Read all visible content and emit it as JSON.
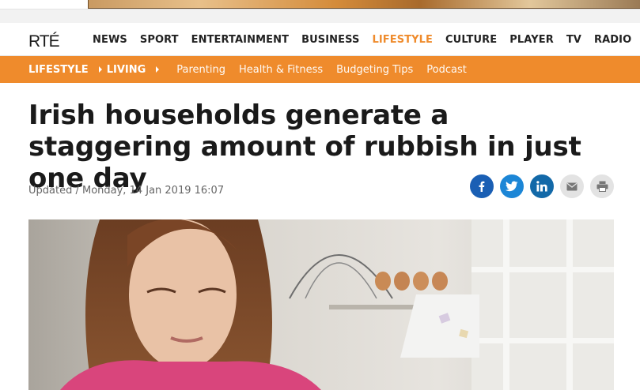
{
  "logo": {
    "text": "RTÉ"
  },
  "main_nav": {
    "items": [
      {
        "label": "NEWS",
        "active": false
      },
      {
        "label": "SPORT",
        "active": false
      },
      {
        "label": "ENTERTAINMENT",
        "active": false
      },
      {
        "label": "BUSINESS",
        "active": false
      },
      {
        "label": "LIFESTYLE",
        "active": true
      },
      {
        "label": "CULTURE",
        "active": false
      },
      {
        "label": "PLAYER",
        "active": false
      },
      {
        "label": "TV",
        "active": false
      },
      {
        "label": "RADIO",
        "active": false
      }
    ]
  },
  "sub_nav": {
    "section": "LIFESTYLE",
    "subsection": "LIVING",
    "links": [
      "Parenting",
      "Health & Fitness",
      "Budgeting Tips",
      "Podcast"
    ]
  },
  "article": {
    "headline": "Irish households generate a staggering amount of rubbish in just one day",
    "updated": "Updated / Monday, 14 Jan 2019 16:07"
  },
  "share_buttons": [
    {
      "icon": "facebook-icon"
    },
    {
      "icon": "twitter-icon"
    },
    {
      "icon": "linkedin-icon"
    },
    {
      "icon": "email-icon"
    },
    {
      "icon": "print-icon"
    }
  ],
  "colors": {
    "accent": "#ef8b2c",
    "facebook": "#1a5fb4",
    "twitter": "#1c86d6",
    "linkedin": "#1369a8",
    "text": "#1a1a1a"
  }
}
